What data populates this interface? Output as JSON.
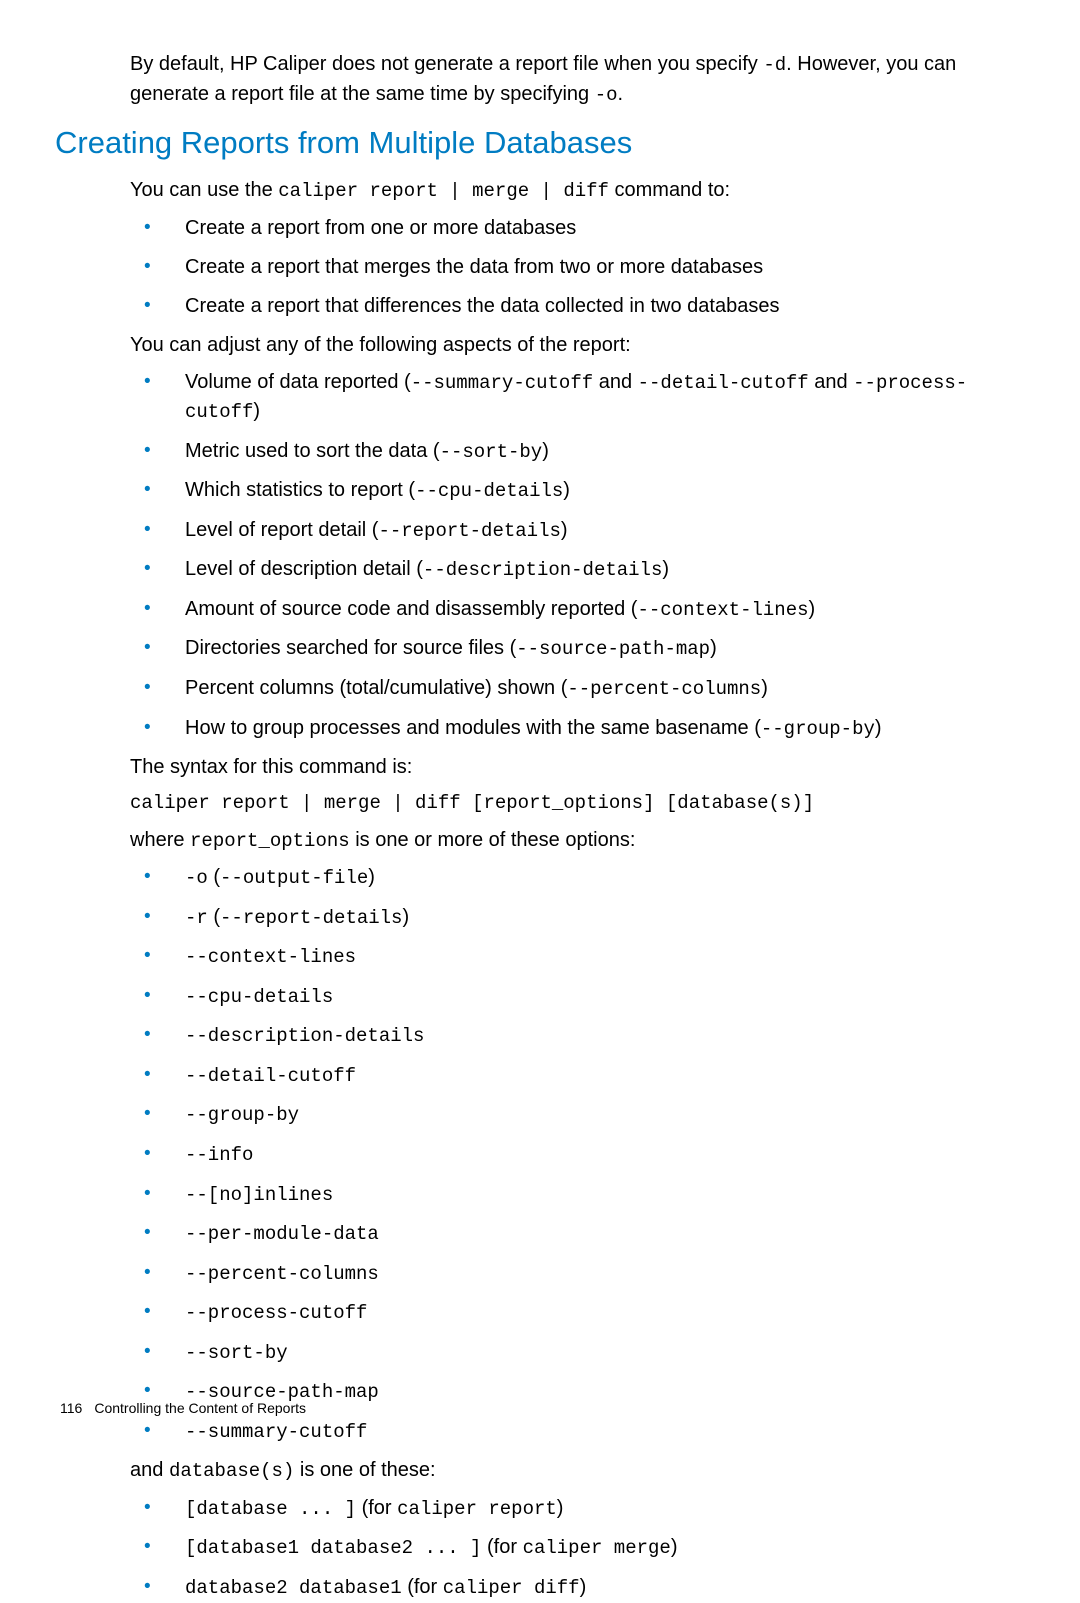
{
  "intro": {
    "t1": "By default, HP Caliper does not generate a report file when you specify ",
    "c1": "-d",
    "t2": ". However, you can generate a report file at the same time by specifying ",
    "c2": "-o",
    "t3": "."
  },
  "heading": "Creating Reports from Multiple Databases",
  "p1": {
    "t1": "You can use the ",
    "c1": "caliper report | merge | diff",
    "t2": " command to:"
  },
  "list1": {
    "i0": "Create a report from one or more databases",
    "i1": "Create a report that merges the data from two or more databases",
    "i2": "Create a report that differences the data collected in two databases"
  },
  "p2": "You can adjust any of the following aspects of the report:",
  "list2": {
    "i0": {
      "t1": "Volume of data reported (",
      "c1": "--summary-cutoff",
      "t2": " and ",
      "c2": "--detail-cutoff",
      "t3": " and ",
      "c3": "--process-cutoff",
      "t4": ")"
    },
    "i1": {
      "t1": "Metric used to sort the data (",
      "c1": "--sort-by",
      "t2": ")"
    },
    "i2": {
      "t1": "Which statistics to report (",
      "c1": "--cpu-details",
      "t2": ")"
    },
    "i3": {
      "t1": "Level of report detail (",
      "c1": "--report-details",
      "t2": ")"
    },
    "i4": {
      "t1": "Level of description detail (",
      "c1": "--description-details",
      "t2": ")"
    },
    "i5": {
      "t1": "Amount of source code and disassembly reported (",
      "c1": "--context-lines",
      "t2": ")"
    },
    "i6": {
      "t1": "Directories searched for source files (",
      "c1": "--source-path-map",
      "t2": ")"
    },
    "i7": {
      "t1": "Percent columns (total/cumulative) shown (",
      "c1": "--percent-columns",
      "t2": ")"
    },
    "i8": {
      "t1": "How to group processes and modules with the same basename (",
      "c1": "--group-by",
      "t2": ")"
    }
  },
  "p3": "The syntax for this command is:",
  "cmd": "caliper report | merge | diff [report_options] [database(s)]",
  "p4": {
    "t1": "where ",
    "c1": "report_options",
    "t2": " is one or more of these options:"
  },
  "list3": {
    "i0": {
      "c1": "-o",
      "t1": " (",
      "c2": "--output-file",
      "t2": ")"
    },
    "i1": {
      "c1": "-r",
      "t1": " (",
      "c2": "--report-details",
      "t2": ")"
    },
    "i2": {
      "c1": "--context-lines"
    },
    "i3": {
      "c1": "--cpu-details"
    },
    "i4": {
      "c1": "--description-details"
    },
    "i5": {
      "c1": "--detail-cutoff"
    },
    "i6": {
      "c1": "--group-by"
    },
    "i7": {
      "c1": "--info"
    },
    "i8": {
      "c1": "--[no]inlines"
    },
    "i9": {
      "c1": "--per-module-data"
    },
    "i10": {
      "c1": "--percent-columns"
    },
    "i11": {
      "c1": "--process-cutoff"
    },
    "i12": {
      "c1": "--sort-by"
    },
    "i13": {
      "c1": "--source-path-map"
    },
    "i14": {
      "c1": "--summary-cutoff"
    }
  },
  "p5": {
    "t1": "and ",
    "c1": "database(s)",
    "t2": " is one of these:"
  },
  "list4": {
    "i0": {
      "c1": "[database ... ]",
      "t1": " (for ",
      "c2": "caliper report",
      "t2": ")"
    },
    "i1": {
      "c1": "[database1 database2 ... ]",
      "t1": " (for ",
      "c2": "caliper merge",
      "t2": ")"
    },
    "i2": {
      "c1": "database2 database1",
      "t1": " (for ",
      "c2": "caliper diff",
      "t2": ")"
    }
  },
  "footer": {
    "page": "116",
    "title": "Controlling the Content of Reports"
  }
}
